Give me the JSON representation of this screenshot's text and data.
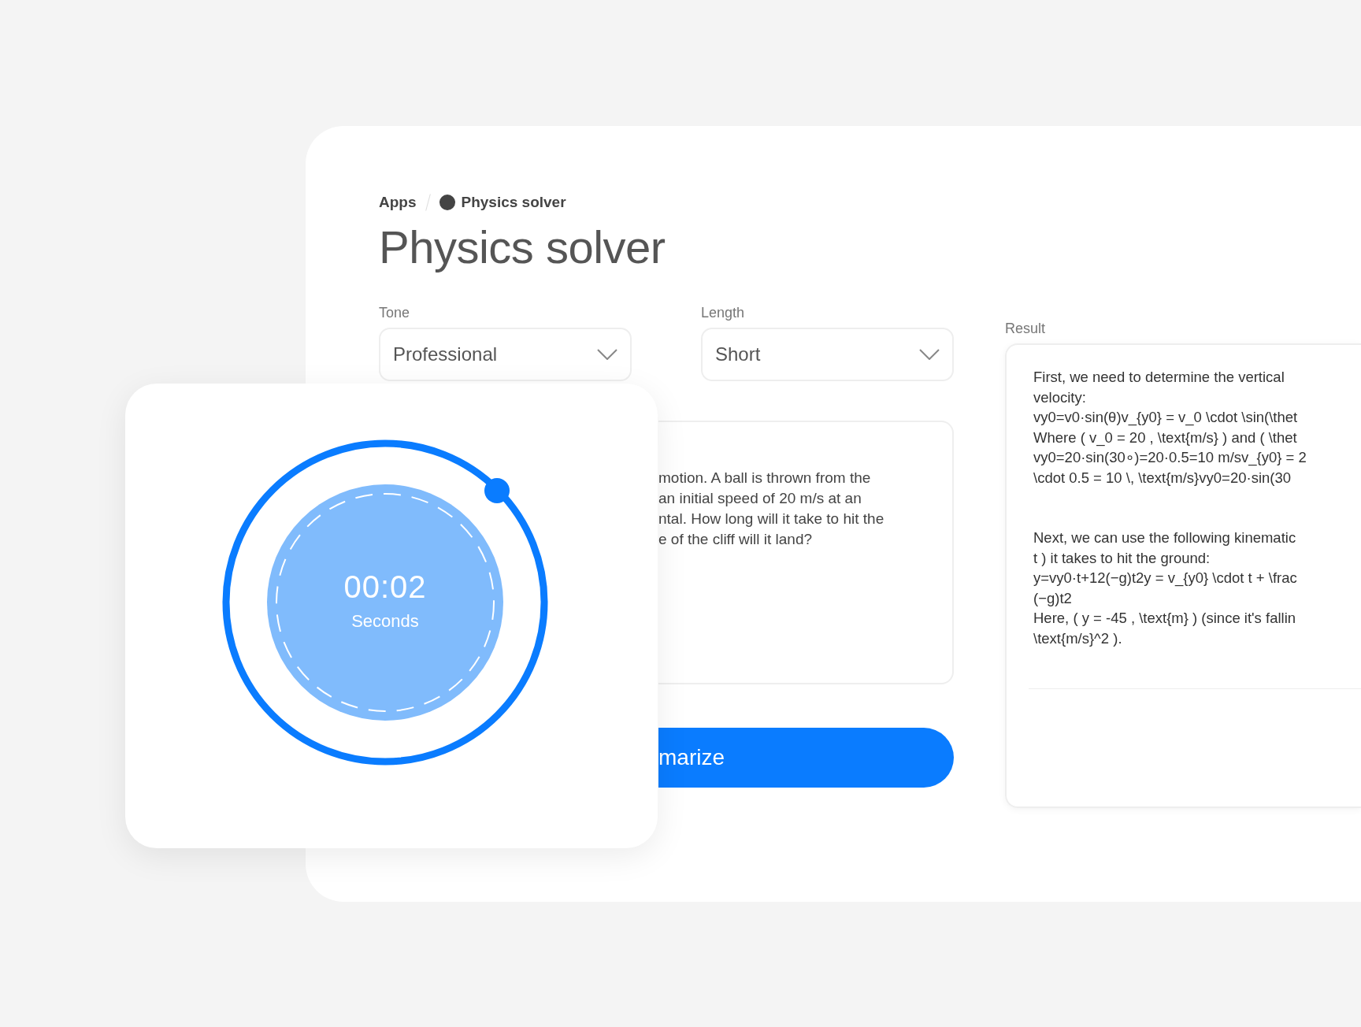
{
  "breadcrumb": {
    "items": [
      "Apps",
      "Physics solver"
    ]
  },
  "title": "Physics solver",
  "fields": [
    {
      "label": "Tone",
      "value": "Professional"
    },
    {
      "label": "Length",
      "value": "Short"
    }
  ],
  "prompt": {
    "lines": [
      "motion. A ball is thrown from the",
      "an initial speed of 20 m/s at an",
      "ntal. How long will it take to hit the",
      "e of the cliff will it land?"
    ]
  },
  "submit_button": "marize",
  "result": {
    "label": "Result",
    "paragraphs": [
      [
        "First, we need to determine the vertical",
        "velocity:",
        "vy0=v0·sin(θ)v_{y0} = v_0 \\cdot \\sin(\\thet",
        "Where ( v_0 = 20 , \\text{m/s} ) and ( \\thet",
        "vy0=20·sin(30∘)=20·0.5=10 m/sv_{y0} = 2",
        "\\cdot 0.5 = 10 \\, \\text{m/s}vy0=20·sin(30"
      ],
      [
        "Next, we can use the following kinematic",
        "t ) it takes to hit the ground:",
        "y=vy0·t+12(−g)t2y = v_{y0} \\cdot t + \\frac",
        "(−g)t2",
        "Here, ( y = -45 , \\text{m} ) (since it's fallin",
        "\\text{m/s}^2 )."
      ]
    ]
  },
  "timer": {
    "time": "00:02",
    "unit": "Seconds"
  }
}
